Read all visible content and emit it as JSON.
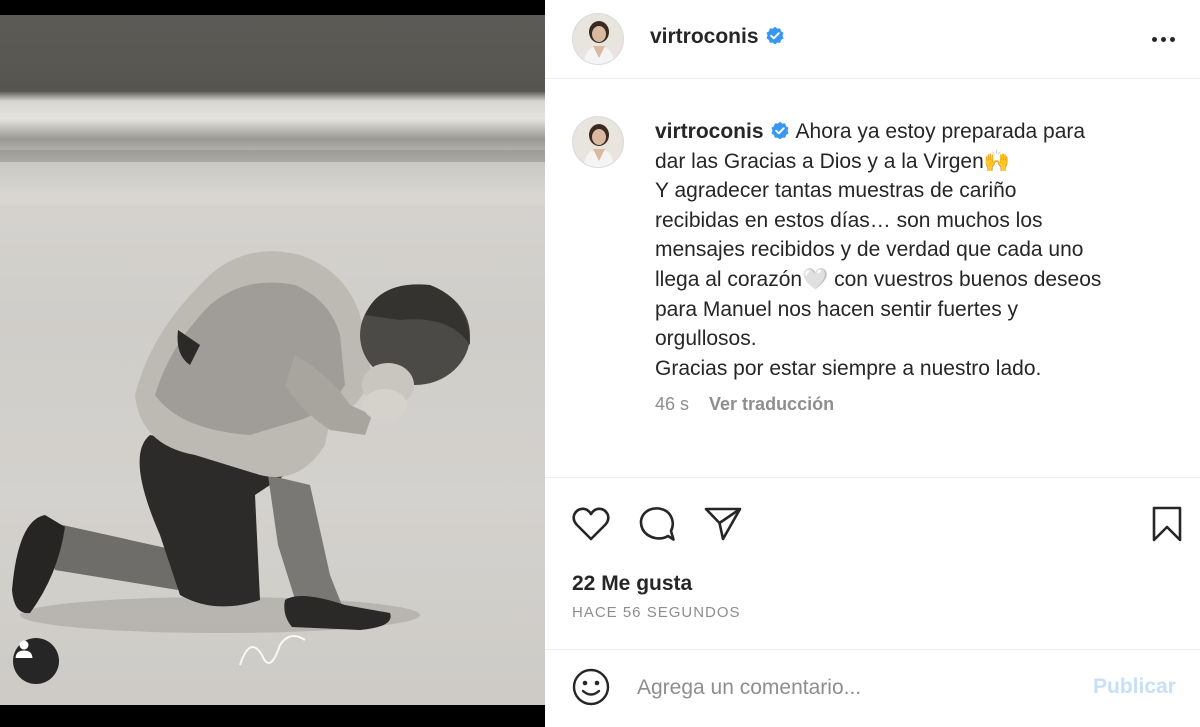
{
  "post": {
    "username": "virtroconis",
    "verified": true,
    "caption_lines": [
      "Ahora ya estoy preparada para",
      "dar las Gracias a Dios y a la Virgen🙌",
      "Y agradecer tantas muestras de cariño",
      "recibidas en estos días… son muchos los",
      "mensajes recibidos y de verdad que cada uno",
      "llega al corazón🤍 con vuestros buenos deseos",
      "para Manuel nos hacen sentir fuertes y",
      "orgullosos.",
      "Gracias por estar siempre a nuestro lado."
    ],
    "caption_age": "46 s",
    "see_translation": "Ver traducción",
    "likes": "22 Me gusta",
    "timestamp": "HACE 56 SEGUNDOS"
  },
  "comment": {
    "placeholder": "Agrega un comentario...",
    "post_label": "Publicar"
  },
  "icons": {
    "like": "heart-icon",
    "comment": "comment-bubble-icon",
    "share": "paper-plane-icon",
    "save": "bookmark-icon",
    "emoji": "smiley-icon",
    "more": "more-options-icon",
    "verified": "verified-badge-icon",
    "user_tag": "user-tag-icon"
  },
  "colors": {
    "verified_blue": "#3897f0",
    "post_button_disabled": "#c7e0f7",
    "muted_text": "#8e8e8e"
  }
}
